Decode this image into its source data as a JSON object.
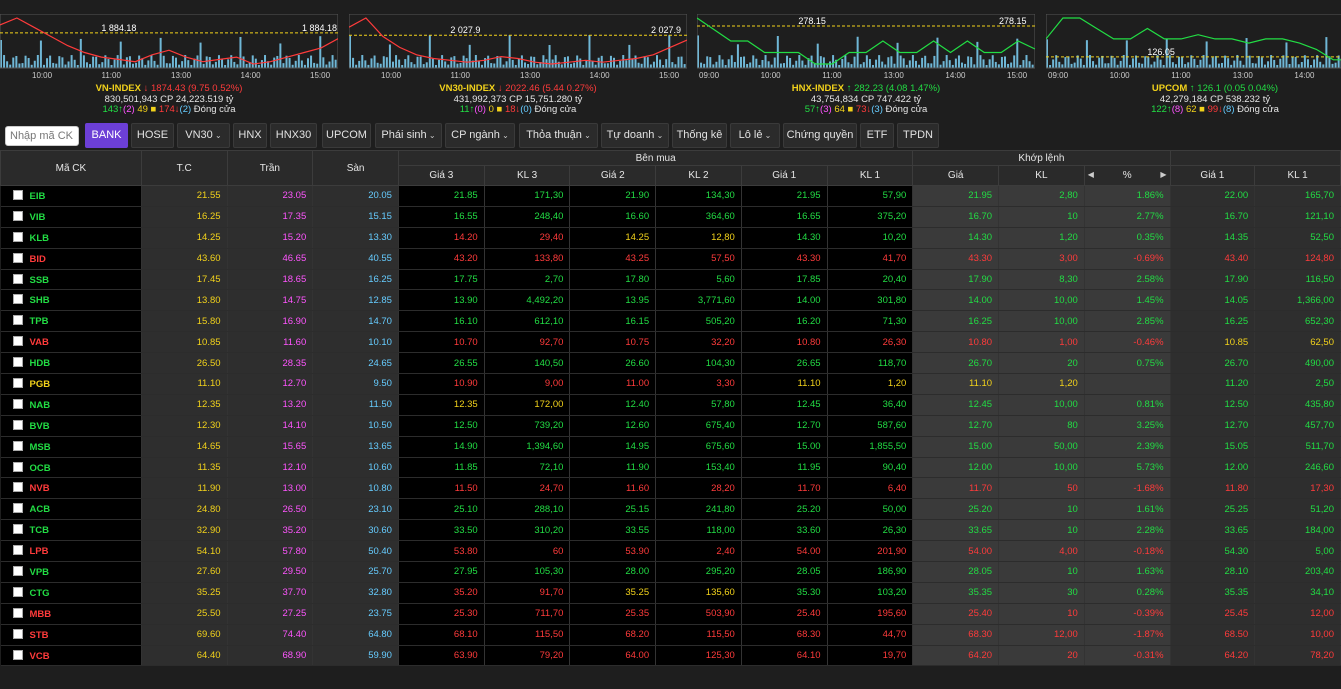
{
  "indices": [
    {
      "chart_data": {
        "type": "line",
        "x_ticks": [
          "10:00",
          "11:00",
          "13:00",
          "14:00",
          "15:00"
        ],
        "ref_label": "1 884.18",
        "last_label": "1 884.18",
        "values": [
          1890,
          1893,
          1889,
          1885,
          1881,
          1878,
          1876,
          1875,
          1874,
          1877,
          1879,
          1876,
          1874,
          1875,
          1876,
          1873,
          1874,
          1876,
          1878,
          1880,
          1884
        ]
      },
      "name": "VN-INDEX",
      "arrow": "↓",
      "value": "1874.43",
      "change": "(9.75  0.52%)",
      "volume": "830,501,943",
      "cp_label": "CP",
      "cp_value": "24,223.519 tỷ",
      "adv": "143",
      "adv_ce": "(2)",
      "ref_count": "49",
      "dec": "174",
      "dec_fl": "(2)",
      "status": "Đóng cửa"
    },
    {
      "chart_data": {
        "type": "line",
        "x_ticks": [
          "10:00",
          "11:00",
          "13:00",
          "14:00",
          "15:00"
        ],
        "ref_label": "2 027.9",
        "last_label": "2 027.9",
        "values": [
          2035,
          2040,
          2030,
          2024,
          2020,
          2018,
          2017,
          2016,
          2017,
          2019,
          2018,
          2016,
          2015,
          2016,
          2017,
          2016,
          2017,
          2018,
          2020,
          2024,
          2028
        ]
      },
      "name": "VN30-INDEX",
      "arrow": "↓",
      "value": "2022.46",
      "change": "(5.44  0.27%)",
      "volume": "431,992,373",
      "cp_label": "CP",
      "cp_value": "15,751.280 tỷ",
      "adv": "11",
      "adv_ce": "(0)",
      "ref_count": "0",
      "dec": "18",
      "dec_fl": "(0)",
      "status": "Đóng cửa"
    },
    {
      "chart_data": {
        "type": "line",
        "x_ticks": [
          "09:00",
          "10:00",
          "11:00",
          "13:00",
          "14:00",
          "15:00"
        ],
        "ref_label": "278.15",
        "last_label": "278.15",
        "values": [
          282.5,
          282.4,
          282.3,
          282.3,
          282.2,
          282.2,
          282.2,
          282.1,
          282.1,
          282.2,
          282.2,
          282.3,
          282.2,
          282.2,
          282.3,
          282.2,
          282.3,
          282.2,
          282.2,
          282.3,
          282.23
        ]
      },
      "name": "HNX-INDEX",
      "arrow": "↑",
      "value": "282.23",
      "change": "(4.08  1.47%)",
      "volume": "43,754,834",
      "cp_label": "CP",
      "cp_value": "747.422 tỷ",
      "adv": "57",
      "adv_ce": "(3)",
      "ref_count": "64",
      "dec": "73",
      "dec_fl": "(3)",
      "status": "Đóng cửa"
    },
    {
      "chart_data": {
        "type": "line",
        "x_ticks": [
          "09:00",
          "10:00",
          "11:00",
          "13:00",
          "14:00",
          "15:00"
        ],
        "ref_label": "126.05",
        "last_label": "",
        "values": [
          126.2,
          126.3,
          126.3,
          126.25,
          126.2,
          126.2,
          126.25,
          126.2,
          126.2,
          126.22,
          126.2,
          126.2,
          126.18,
          126.2,
          126.2,
          126.18,
          126.15,
          126.1,
          126.1,
          126.08,
          126.1
        ]
      },
      "name": "UPCOM",
      "arrow": "↑",
      "value": "126.1",
      "change": "(0.05  0.04%)",
      "volume": "42,279,184",
      "cp_label": "CP",
      "cp_value": "538.232 tỷ",
      "adv": "122",
      "adv_ce": "(8)",
      "ref_count": "62",
      "dec": "99",
      "dec_fl": "(8)",
      "status": "Đóng cửa"
    }
  ],
  "toolbar": {
    "search_placeholder": "Nhập mã CK",
    "items": [
      {
        "label": "BANK",
        "active": true,
        "dropdown": false
      },
      {
        "label": "HOSE",
        "active": false,
        "dropdown": false
      },
      {
        "label": "VN30",
        "active": false,
        "dropdown": true
      },
      {
        "label": "HNX",
        "active": false,
        "dropdown": false
      },
      {
        "label": "HNX30",
        "active": false,
        "dropdown": false
      },
      {
        "label": "UPCOM",
        "active": false,
        "dropdown": false
      },
      {
        "label": "Phái sinh",
        "active": false,
        "dropdown": true
      },
      {
        "label": "CP ngành",
        "active": false,
        "dropdown": true
      },
      {
        "label": "Thỏa thuận",
        "active": false,
        "dropdown": true
      },
      {
        "label": "Tự doanh",
        "active": false,
        "dropdown": true
      },
      {
        "label": "Thống kê",
        "active": false,
        "dropdown": false
      },
      {
        "label": "Lô lẻ",
        "active": false,
        "dropdown": true
      },
      {
        "label": "Chứng quyền",
        "active": false,
        "dropdown": false
      },
      {
        "label": "ETF",
        "active": false,
        "dropdown": false
      },
      {
        "label": "TPDN",
        "active": false,
        "dropdown": false
      }
    ]
  },
  "table": {
    "group_headers": {
      "ticker": "Mã CK",
      "ref": "T.C",
      "ceil": "Trần",
      "floor": "Sàn",
      "buy": "Bên mua",
      "match": "Khớp lệnh"
    },
    "sub_headers": [
      "Giá 3",
      "KL 3",
      "Giá 2",
      "KL 2",
      "Giá 1",
      "KL 1",
      "Giá",
      "KL",
      "%",
      "Giá 1",
      "KL 1"
    ],
    "rows": [
      {
        "t": "EIB",
        "tc": "21.55",
        "tr": "23.05",
        "s": "20.05",
        "b3": "21.85",
        "v3": "171,30",
        "b2": "21.90",
        "v2": "134,30",
        "b1": "21.95",
        "v1": "57,90",
        "p": "21.95",
        "kl": "2,80",
        "pct": "1.86%",
        "a1": "22.00",
        "av1": "165,70",
        "c": "up"
      },
      {
        "t": "VIB",
        "tc": "16.25",
        "tr": "17.35",
        "s": "15.15",
        "b3": "16.55",
        "v3": "248,40",
        "b2": "16.60",
        "v2": "364,60",
        "b1": "16.65",
        "v1": "375,20",
        "p": "16.70",
        "kl": "10",
        "pct": "2.77%",
        "a1": "16.70",
        "av1": "121,10",
        "c": "up"
      },
      {
        "t": "KLB",
        "tc": "14.25",
        "tr": "15.20",
        "s": "13.30",
        "b3": "14.20",
        "v3": "29,40",
        "b2": "14.25",
        "v2": "12,80",
        "b1": "14.30",
        "v1": "10,20",
        "p": "14.30",
        "kl": "1,20",
        "pct": "0.35%",
        "a1": "14.35",
        "av1": "52,50",
        "c": "up"
      },
      {
        "t": "BID",
        "tc": "43.60",
        "tr": "46.65",
        "s": "40.55",
        "b3": "43.20",
        "v3": "133,80",
        "b2": "43.25",
        "v2": "57,50",
        "b1": "43.30",
        "v1": "41,70",
        "p": "43.30",
        "kl": "3,00",
        "pct": "-0.69%",
        "a1": "43.40",
        "av1": "124,80",
        "c": "dn"
      },
      {
        "t": "SSB",
        "tc": "17.45",
        "tr": "18.65",
        "s": "16.25",
        "b3": "17.75",
        "v3": "2,70",
        "b2": "17.80",
        "v2": "5,60",
        "b1": "17.85",
        "v1": "20,40",
        "p": "17.90",
        "kl": "8,30",
        "pct": "2.58%",
        "a1": "17.90",
        "av1": "116,50",
        "c": "up"
      },
      {
        "t": "SHB",
        "tc": "13.80",
        "tr": "14.75",
        "s": "12.85",
        "b3": "13.90",
        "v3": "4,492,20",
        "b2": "13.95",
        "v2": "3,771,60",
        "b1": "14.00",
        "v1": "301,80",
        "p": "14.00",
        "kl": "10,00",
        "pct": "1.45%",
        "a1": "14.05",
        "av1": "1,366,00",
        "c": "up"
      },
      {
        "t": "TPB",
        "tc": "15.80",
        "tr": "16.90",
        "s": "14.70",
        "b3": "16.10",
        "v3": "612,10",
        "b2": "16.15",
        "v2": "505,20",
        "b1": "16.20",
        "v1": "71,30",
        "p": "16.25",
        "kl": "10,00",
        "pct": "2.85%",
        "a1": "16.25",
        "av1": "652,30",
        "c": "up"
      },
      {
        "t": "VAB",
        "tc": "10.85",
        "tr": "11.60",
        "s": "10.10",
        "b3": "10.70",
        "v3": "92,70",
        "b2": "10.75",
        "v2": "32,20",
        "b1": "10.80",
        "v1": "26,30",
        "p": "10.80",
        "kl": "1,00",
        "pct": "-0.46%",
        "a1": "10.85",
        "av1": "62,50",
        "c": "dn"
      },
      {
        "t": "HDB",
        "tc": "26.50",
        "tr": "28.35",
        "s": "24.65",
        "b3": "26.55",
        "v3": "140,50",
        "b2": "26.60",
        "v2": "104,30",
        "b1": "26.65",
        "v1": "118,70",
        "p": "26.70",
        "kl": "20",
        "pct": "0.75%",
        "a1": "26.70",
        "av1": "490,00",
        "c": "up"
      },
      {
        "t": "PGB",
        "tc": "11.10",
        "tr": "12.70",
        "s": "9.50",
        "b3": "10.90",
        "v3": "9,00",
        "b2": "11.00",
        "v2": "3,30",
        "b1": "11.10",
        "v1": "1,20",
        "p": "11.10",
        "kl": "1,20",
        "pct": "",
        "a1": "11.20",
        "av1": "2,50",
        "c": "ref"
      },
      {
        "t": "NAB",
        "tc": "12.35",
        "tr": "13.20",
        "s": "11.50",
        "b3": "12.35",
        "v3": "172,00",
        "b2": "12.40",
        "v2": "57,80",
        "b1": "12.45",
        "v1": "36,40",
        "p": "12.45",
        "kl": "10,00",
        "pct": "0.81%",
        "a1": "12.50",
        "av1": "435,80",
        "c": "up"
      },
      {
        "t": "BVB",
        "tc": "12.30",
        "tr": "14.10",
        "s": "10.50",
        "b3": "12.50",
        "v3": "739,20",
        "b2": "12.60",
        "v2": "675,40",
        "b1": "12.70",
        "v1": "587,60",
        "p": "12.70",
        "kl": "80",
        "pct": "3.25%",
        "a1": "12.70",
        "av1": "457,70",
        "c": "up"
      },
      {
        "t": "MSB",
        "tc": "14.65",
        "tr": "15.65",
        "s": "13.65",
        "b3": "14.90",
        "v3": "1,394,60",
        "b2": "14.95",
        "v2": "675,60",
        "b1": "15.00",
        "v1": "1,855,50",
        "p": "15.00",
        "kl": "50,00",
        "pct": "2.39%",
        "a1": "15.05",
        "av1": "511,70",
        "c": "up"
      },
      {
        "t": "OCB",
        "tc": "11.35",
        "tr": "12.10",
        "s": "10.60",
        "b3": "11.85",
        "v3": "72,10",
        "b2": "11.90",
        "v2": "153,40",
        "b1": "11.95",
        "v1": "90,40",
        "p": "12.00",
        "kl": "10,00",
        "pct": "5.73%",
        "a1": "12.00",
        "av1": "246,60",
        "c": "up"
      },
      {
        "t": "NVB",
        "tc": "11.90",
        "tr": "13.00",
        "s": "10.80",
        "b3": "11.50",
        "v3": "24,70",
        "b2": "11.60",
        "v2": "28,20",
        "b1": "11.70",
        "v1": "6,40",
        "p": "11.70",
        "kl": "50",
        "pct": "-1.68%",
        "a1": "11.80",
        "av1": "17,30",
        "c": "dn"
      },
      {
        "t": "ACB",
        "tc": "24.80",
        "tr": "26.50",
        "s": "23.10",
        "b3": "25.10",
        "v3": "288,10",
        "b2": "25.15",
        "v2": "241,80",
        "b1": "25.20",
        "v1": "50,00",
        "p": "25.20",
        "kl": "10",
        "pct": "1.61%",
        "a1": "25.25",
        "av1": "51,20",
        "c": "up"
      },
      {
        "t": "TCB",
        "tc": "32.90",
        "tr": "35.20",
        "s": "30.60",
        "b3": "33.50",
        "v3": "310,20",
        "b2": "33.55",
        "v2": "118,00",
        "b1": "33.60",
        "v1": "26,30",
        "p": "33.65",
        "kl": "10",
        "pct": "2.28%",
        "a1": "33.65",
        "av1": "184,00",
        "c": "up"
      },
      {
        "t": "LPB",
        "tc": "54.10",
        "tr": "57.80",
        "s": "50.40",
        "b3": "53.80",
        "v3": "60",
        "b2": "53.90",
        "v2": "2,40",
        "b1": "54.00",
        "v1": "201,90",
        "p": "54.00",
        "kl": "4,00",
        "pct": "-0.18%",
        "a1": "54.30",
        "av1": "5,00",
        "c": "dn"
      },
      {
        "t": "VPB",
        "tc": "27.60",
        "tr": "29.50",
        "s": "25.70",
        "b3": "27.95",
        "v3": "105,30",
        "b2": "28.00",
        "v2": "295,20",
        "b1": "28.05",
        "v1": "186,90",
        "p": "28.05",
        "kl": "10",
        "pct": "1.63%",
        "a1": "28.10",
        "av1": "203,40",
        "c": "up"
      },
      {
        "t": "CTG",
        "tc": "35.25",
        "tr": "37.70",
        "s": "32.80",
        "b3": "35.20",
        "v3": "91,70",
        "b2": "35.25",
        "v2": "135,60",
        "b1": "35.30",
        "v1": "103,20",
        "p": "35.35",
        "kl": "30",
        "pct": "0.28%",
        "a1": "35.35",
        "av1": "34,10",
        "c": "up"
      },
      {
        "t": "MBB",
        "tc": "25.50",
        "tr": "27.25",
        "s": "23.75",
        "b3": "25.30",
        "v3": "711,70",
        "b2": "25.35",
        "v2": "503,90",
        "b1": "25.40",
        "v1": "195,60",
        "p": "25.40",
        "kl": "10",
        "pct": "-0.39%",
        "a1": "25.45",
        "av1": "12,00",
        "c": "dn"
      },
      {
        "t": "STB",
        "tc": "69.60",
        "tr": "74.40",
        "s": "64.80",
        "b3": "68.10",
        "v3": "115,50",
        "b2": "68.20",
        "v2": "115,50",
        "b1": "68.30",
        "v1": "44,70",
        "p": "68.30",
        "kl": "12,00",
        "pct": "-1.87%",
        "a1": "68.50",
        "av1": "10,00",
        "c": "dn"
      },
      {
        "t": "VCB",
        "tc": "64.40",
        "tr": "68.90",
        "s": "59.90",
        "b3": "63.90",
        "v3": "79,20",
        "b2": "64.00",
        "v2": "125,30",
        "b1": "64.10",
        "v1": "19,70",
        "p": "64.20",
        "kl": "20",
        "pct": "-0.31%",
        "a1": "64.20",
        "av1": "78,20",
        "c": "dn"
      }
    ]
  },
  "colors": {
    "up": "#22dd44",
    "down": "#ff3b3b",
    "ref": "#f2d21b",
    "ceil": "#ff55ff",
    "floor": "#66ccff",
    "accent": "#6c3fd6"
  }
}
